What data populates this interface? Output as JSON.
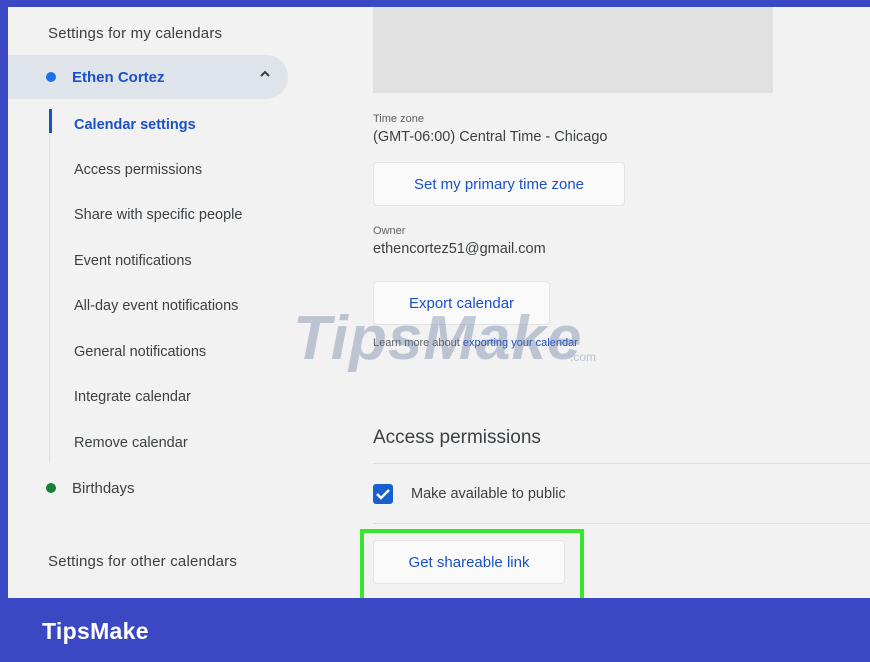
{
  "sidebar": {
    "my_calendars_title": "Settings for my calendars",
    "primary_calendar": {
      "name": "Ethen Cortez",
      "color": "#1a73e8"
    },
    "nav_items": [
      {
        "label": "Calendar settings"
      },
      {
        "label": "Access permissions"
      },
      {
        "label": "Share with specific people"
      },
      {
        "label": "Event notifications"
      },
      {
        "label": "All-day event notifications"
      },
      {
        "label": "General notifications"
      },
      {
        "label": "Integrate calendar"
      },
      {
        "label": "Remove calendar"
      }
    ],
    "secondary_calendar": {
      "name": "Birthdays",
      "color": "#188038"
    },
    "other_calendars_title": "Settings for other calendars"
  },
  "main": {
    "time_zone": {
      "label": "Time zone",
      "value": "(GMT-06:00) Central Time - Chicago",
      "button": "Set my primary time zone"
    },
    "owner": {
      "label": "Owner",
      "value": "ethencortez51@gmail.com"
    },
    "export": {
      "button": "Export calendar",
      "help_prefix": "Learn more about ",
      "help_link": "exporting your calendar"
    },
    "access": {
      "heading": "Access permissions",
      "public_checkbox_label": "Make available to public",
      "public_checked": true,
      "shareable_button": "Get shareable link"
    }
  },
  "watermark": {
    "text": "TipsMake",
    "suffix": ".com"
  },
  "footer": {
    "brand": "TipsMake"
  },
  "colors": {
    "accent": "#1a50c9",
    "footer_bg": "#3b48c4",
    "highlight": "#36e62e"
  }
}
